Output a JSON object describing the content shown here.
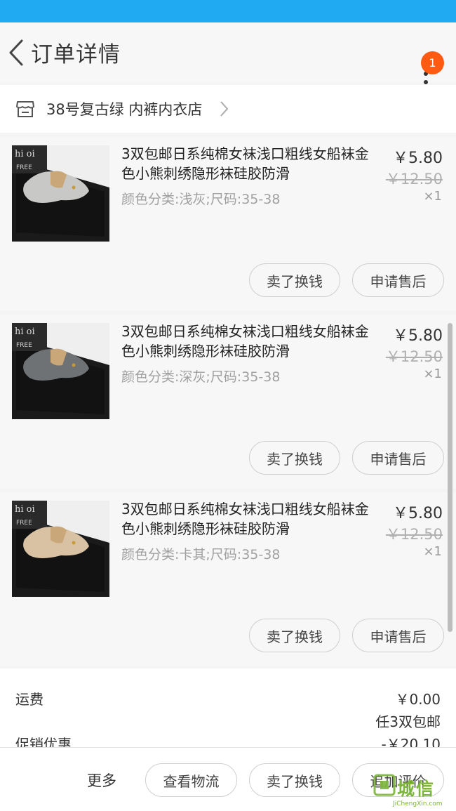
{
  "header": {
    "title": "订单详情",
    "badge_count": "1"
  },
  "shop": {
    "name": "38号复古绿 内裤内衣店"
  },
  "items": [
    {
      "title": "3双包邮日系纯棉女袜浅口粗线女船袜金色小熊刺绣隐形袜硅胶防滑",
      "variant": "颜色分类:浅灰;尺码:35-38",
      "price": "￥5.80",
      "original_price": "￥12.50",
      "quantity": "×1",
      "sell_label": "卖了换钱",
      "aftersale_label": "申请售后",
      "sock_color": "#c8c8c6"
    },
    {
      "title": "3双包邮日系纯棉女袜浅口粗线女船袜金色小熊刺绣隐形袜硅胶防滑",
      "variant": "颜色分类:深灰;尺码:35-38",
      "price": "￥5.80",
      "original_price": "￥12.50",
      "quantity": "×1",
      "sell_label": "卖了换钱",
      "aftersale_label": "申请售后",
      "sock_color": "#6f7275"
    },
    {
      "title": "3双包邮日系纯棉女袜浅口粗线女船袜金色小熊刺绣隐形袜硅胶防滑",
      "variant": "颜色分类:卡其;尺码:35-38",
      "price": "￥5.80",
      "original_price": "￥12.50",
      "quantity": "×1",
      "sell_label": "卖了换钱",
      "aftersale_label": "申请售后",
      "sock_color": "#d9c2a3"
    }
  ],
  "summary": {
    "shipping_label": "运费",
    "shipping_value": "￥0.00",
    "promo_note": "任3双包邮",
    "promo_label": "促销优惠",
    "promo_value": "-￥20.10"
  },
  "bottom": {
    "more": "更多",
    "logistics": "查看物流",
    "sell": "卖了换钱",
    "review": "追加评价"
  },
  "watermark": {
    "brand": "城信",
    "url": "JiChengXin.com"
  },
  "colors": {
    "status_bar": "#1faaf1",
    "badge": "#ff5a12",
    "accent_green": "#7cb63a"
  }
}
